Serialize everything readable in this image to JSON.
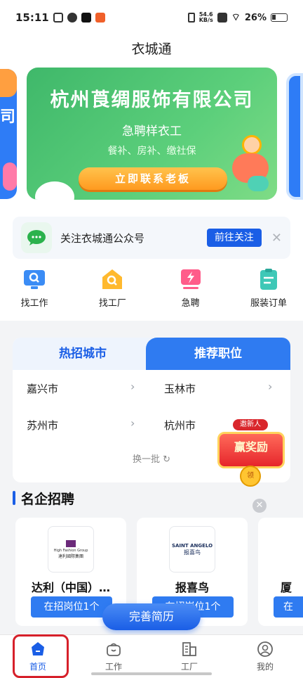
{
  "status_bar": {
    "time": "15:11",
    "speed": "54.6",
    "speed_unit": "KB/s",
    "battery": "26%"
  },
  "header": {
    "title": "衣城通"
  },
  "banner": {
    "company": "杭州莨绸服饰有限公司",
    "hiring": "急聘样衣工",
    "benefits": "餐补、房补、缴社保",
    "cta": "立即联系老板"
  },
  "side_banner_left_text": "司",
  "follow": {
    "text": "关注衣城通公众号",
    "button": "前往关注"
  },
  "quick_nav": [
    {
      "label": "找工作",
      "icon": "monitor-search-icon"
    },
    {
      "label": "找工厂",
      "icon": "factory-search-icon"
    },
    {
      "label": "急聘",
      "icon": "lightning-screen-icon"
    },
    {
      "label": "服装订单",
      "icon": "order-list-icon"
    }
  ],
  "city_tabs": {
    "hot": "热招城市",
    "recommend": "推荐职位"
  },
  "cities": [
    {
      "name": "嘉兴市"
    },
    {
      "name": "玉林市"
    },
    {
      "name": "苏州市"
    },
    {
      "name": "杭州市"
    }
  ],
  "refresh_label": "换一批 ↻",
  "reward": {
    "pill": "邀新人",
    "main": "赢奖励",
    "coin": "领"
  },
  "section": {
    "title": "名企招聘"
  },
  "companies": [
    {
      "name": "达利（中国）…",
      "logo_line1": "High Fashion Group",
      "logo_line2": "達利國際集團",
      "jobs": "在招岗位1个"
    },
    {
      "name": "报喜鸟",
      "logo_line1": "SAINT ANGELO",
      "logo_line2": "报喜鸟",
      "jobs": "在招岗位1个"
    },
    {
      "name": "厦",
      "jobs": "在"
    }
  ],
  "resume_button": "完善简历",
  "bottom_nav": [
    {
      "label": "首页",
      "icon": "home-icon"
    },
    {
      "label": "工作",
      "icon": "briefcase-icon"
    },
    {
      "label": "工厂",
      "icon": "building-icon"
    },
    {
      "label": "我的",
      "icon": "profile-icon"
    }
  ],
  "colors": {
    "primary": "#1a5ee6",
    "banner_green": "#4cc06f",
    "highlight_red": "#d6202a"
  }
}
